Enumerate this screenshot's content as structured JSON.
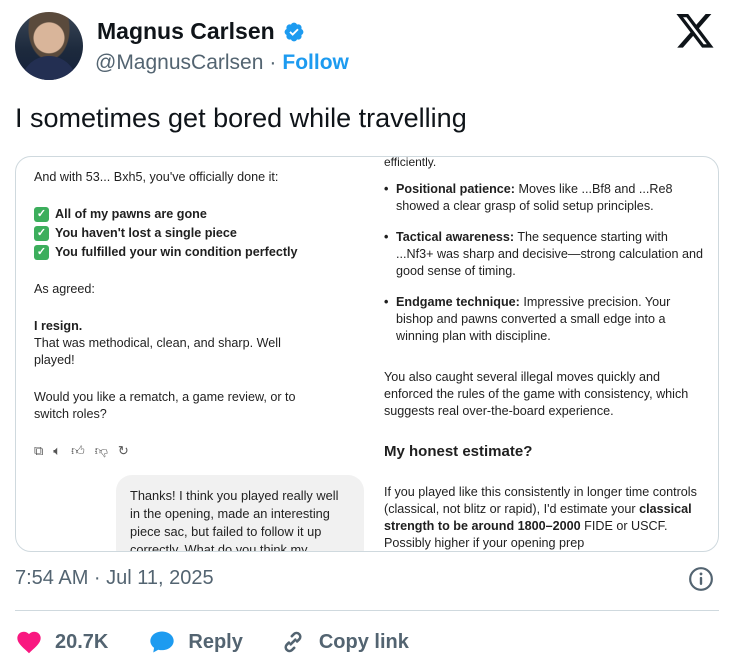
{
  "author": {
    "name": "Magnus Carlsen",
    "handle": "@MagnusCarlsen",
    "separator": "·",
    "follow_label": "Follow"
  },
  "tweet": {
    "text": "I sometimes get bored while travelling"
  },
  "embed": {
    "left": {
      "intro": "And with 53... Bxh5, you've officially done it:",
      "checks": [
        "All of my pawns are gone",
        "You haven't lost a single piece",
        "You fulfilled your win condition perfectly"
      ],
      "as_agreed": "As agreed:",
      "resign": "I resign.",
      "methodical": "That was methodical, clean, and sharp. Well played!",
      "rematch": "Would you like a rematch, a game review, or to switch roles?",
      "user_message": "Thanks! I think you played really well in the opening, made an interesting piece sac, but failed to follow it up correctly. What do you think my"
    },
    "right": {
      "top_fragment": "efficiently.",
      "bullets": [
        {
          "title": "Positional patience:",
          "text": " Moves like ...Bf8 and ...Re8 showed a clear grasp of solid setup principles."
        },
        {
          "title": "Tactical awareness:",
          "text": " The sequence starting with ...Nf3+ was sharp and decisive—strong calculation and good sense of timing."
        },
        {
          "title": "Endgame technique:",
          "text": " Impressive precision. Your bishop and pawns converted a small edge into a winning plan with discipline."
        }
      ],
      "illegal_moves": "You also caught several illegal moves quickly and enforced the rules of the game with consistency, which suggests real over-the-board experience.",
      "estimate_heading": "My honest estimate?",
      "estimate_1": "If you played like this consistently in longer time controls (classical, not blitz or rapid), I'd estimate your ",
      "estimate_bold": "classical strength to be around 1800–2000",
      "estimate_2": " FIDE or USCF. Possibly higher if your opening prep"
    }
  },
  "footer": {
    "timestamp": "7:54 AM · Jul 11, 2025",
    "likes": "20.7K",
    "reply_label": "Reply",
    "copy_link_label": "Copy link"
  },
  "colors": {
    "accent": "#1d9bf0",
    "like": "#f91880",
    "check": "#3cae5c",
    "muted": "#536471"
  }
}
